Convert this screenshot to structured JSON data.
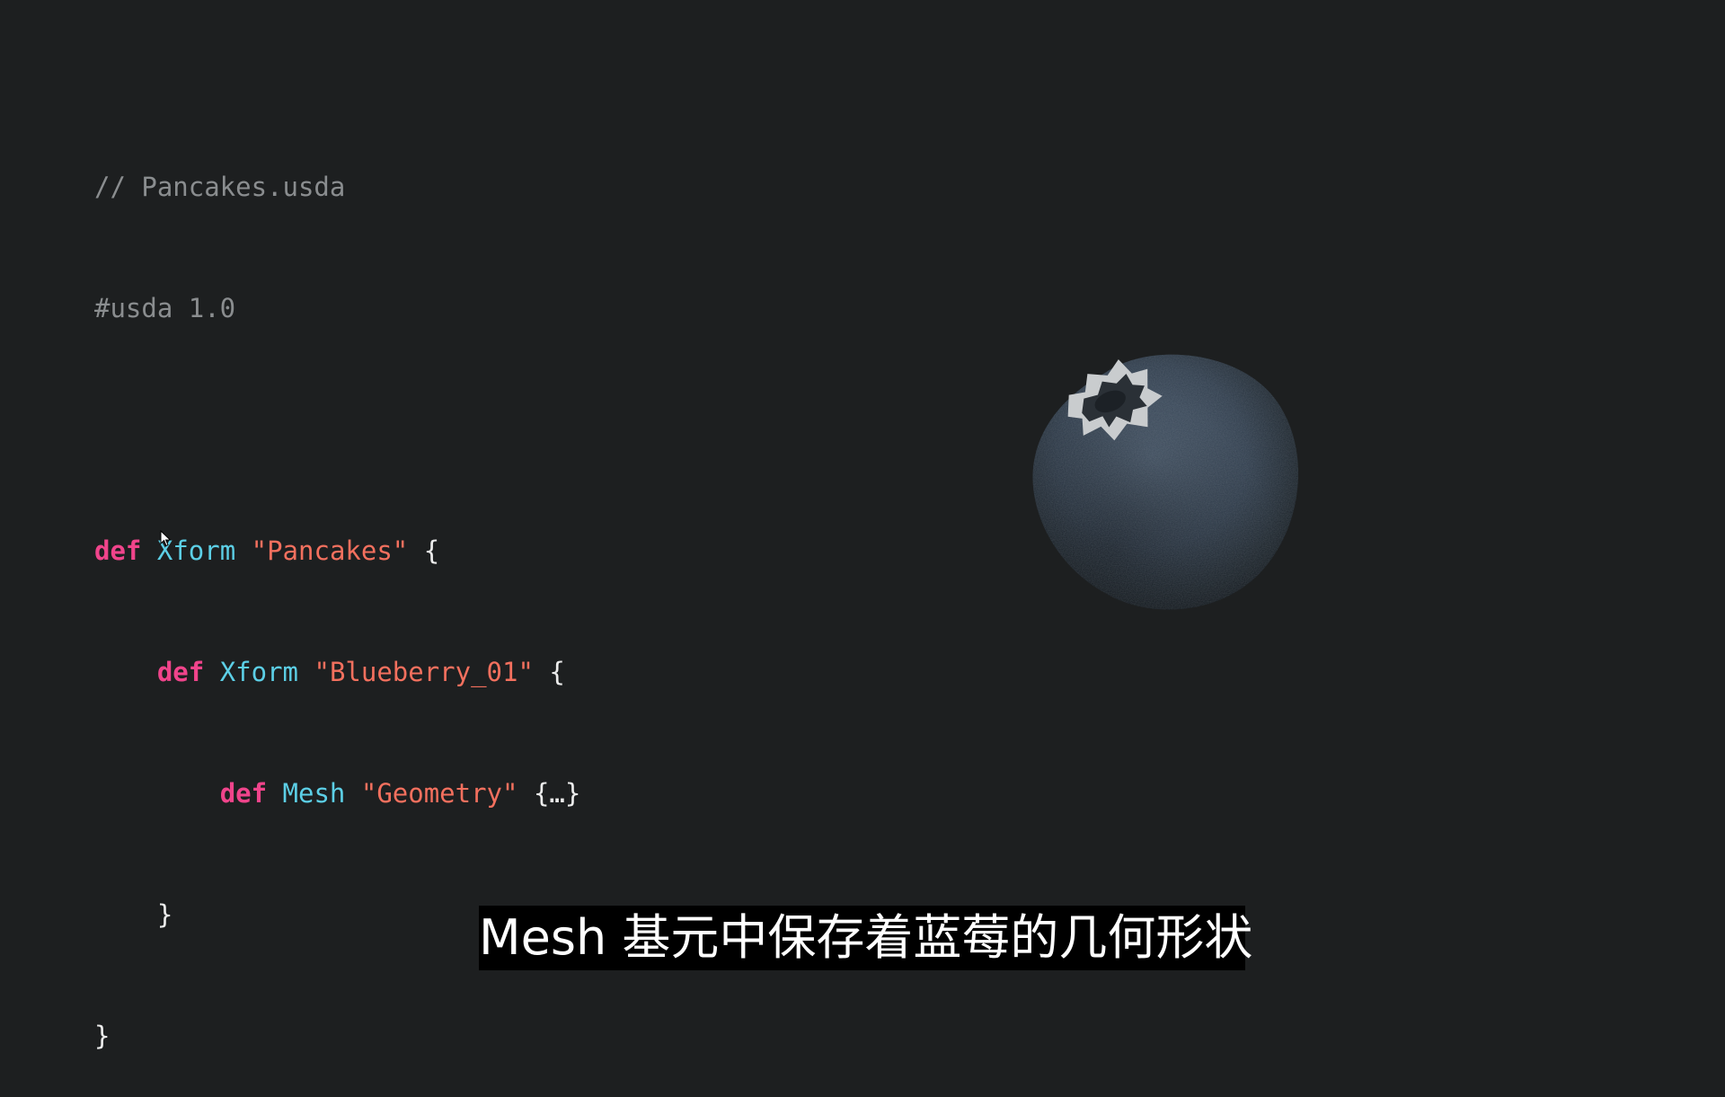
{
  "code": {
    "comment_file": "// Pancakes.usda",
    "header": "#usda 1.0",
    "line1": {
      "kw": "def",
      "type": "Xform",
      "name": "\"Pancakes\"",
      "brace": "{"
    },
    "line2": {
      "kw": "def",
      "type": "Xform",
      "name": "\"Blueberry_01\"",
      "brace": "{"
    },
    "line3": {
      "kw": "def",
      "type": "Mesh",
      "name": "\"Geometry\"",
      "brace": "{…}"
    },
    "line4": {
      "brace": "}"
    },
    "line5": {
      "brace": "}"
    }
  },
  "subtitle": "Mesh 基元中保存着蓝莓的几何形状",
  "colors": {
    "background": "#1d1f20",
    "keyword": "#f0448b",
    "type": "#5ccfe6",
    "string": "#f3705e",
    "comment": "#8a8d8f"
  },
  "icons": [
    "mouse-pointer-icon",
    "blueberry-model-image"
  ]
}
